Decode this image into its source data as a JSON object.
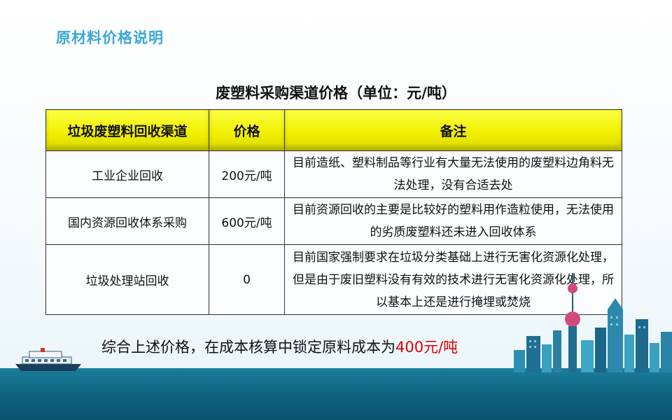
{
  "slide": {
    "title": "原材料价格说明"
  },
  "table": {
    "title": "废塑料采购渠道价格（单位：元/吨）",
    "headers": [
      "垃圾废塑料回收渠道",
      "价格",
      "备注"
    ],
    "rows": [
      {
        "channel": "工业企业回收",
        "price": "200元/吨",
        "remark": "目前造纸、塑料制品等行业有大量无法使用的废塑料边角料无法处理，没有合适去处"
      },
      {
        "channel": "国内资源回收体系采购",
        "price": "600元/吨",
        "remark": "目前资源回收的主要是比较好的塑料用作造粒使用，无法使用的劣质废塑料还未进入回收体系"
      },
      {
        "channel": "垃圾处理站回收",
        "price": "0",
        "remark": "目前国家强制要求在垃圾分类基础上进行无害化资源化处理，但是由于废旧塑料没有有效的技术进行无害化资源化处理，所以基本上还是进行掩埋或焚烧"
      }
    ]
  },
  "summary": {
    "text": "综合上述价格，在成本核算中锁定原料成本为",
    "highlight": "400元/吨"
  },
  "colors": {
    "title": "#3aa8d8",
    "header_bg": "#f2f000",
    "highlight": "#e00000",
    "sea": "#0d5f7c"
  },
  "decorations": {
    "left": "ship-icon",
    "right": "city-skyline-icon"
  }
}
